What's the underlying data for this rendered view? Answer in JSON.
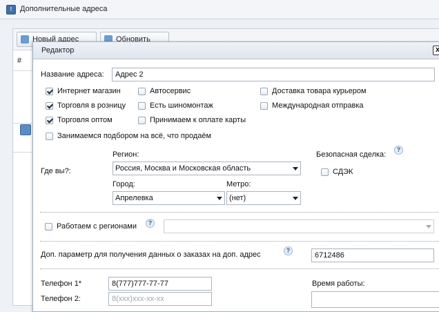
{
  "page": {
    "title": "Дополнительные адреса"
  },
  "list": {
    "toolbar": {
      "new_address": "Новый адрес",
      "refresh": "Обновить"
    },
    "col_hash": "#"
  },
  "dialog": {
    "title": "Редактор",
    "close": "x",
    "address_name_label": "Название адреса:",
    "address_name_value": "Адрес 2",
    "checks": [
      {
        "label": "Интернет магазин",
        "checked": true
      },
      {
        "label": "Автосервис",
        "checked": false
      },
      {
        "label": "Доставка товара курьером",
        "checked": false
      },
      {
        "label": "Торговля в розницу",
        "checked": true
      },
      {
        "label": "Есть шиномонтаж",
        "checked": false
      },
      {
        "label": "Международная отправка",
        "checked": false
      },
      {
        "label": "Торговля оптом",
        "checked": true
      },
      {
        "label": "Принимаем к оплате карты",
        "checked": false
      },
      {
        "label": "Занимаемся подбором на всё, что продаём",
        "checked": false
      }
    ],
    "where_label": "Где вы?:",
    "region_label": "Регион:",
    "region_value": "Россия, Москва и Московская область",
    "city_label": "Город:",
    "city_value": "Апрелевка",
    "metro_label": "Метро:",
    "metro_value": "(нет)",
    "safe_deal_label": "Безопасная сделка:",
    "cdek_label": "СДЭК",
    "regions_label": "Работаем с регионами",
    "regions_value": "",
    "extra_param_label": "Доп. параметр для получения данных о заказах на доп. адрес",
    "extra_param_value": "6712486",
    "phone1_label": "Телефон 1*",
    "phone1_value": "8(777)777-77-77",
    "phone2_label": "Телефон 2:",
    "phone2_placeholder": "8(xxx)xxx-xx-xx",
    "work_time_label": "Время работы:",
    "help": "?"
  }
}
